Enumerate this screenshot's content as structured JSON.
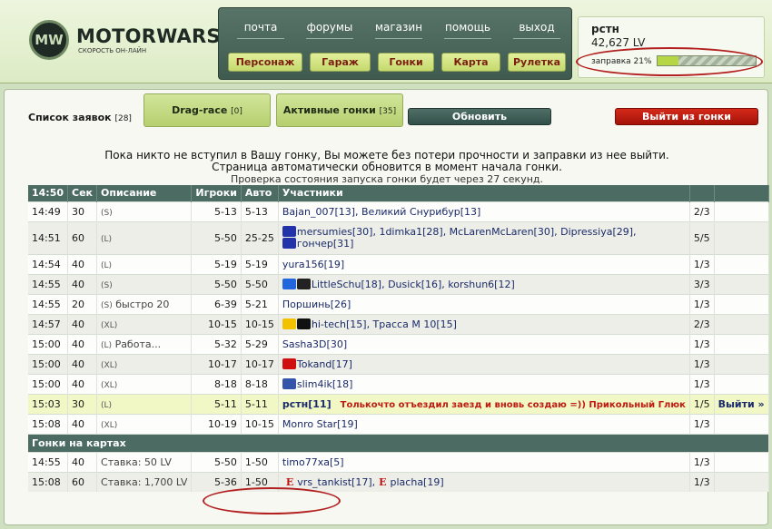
{
  "logo": {
    "mark": "MW",
    "title": "MOTORWARS.RU",
    "subtitle": "скорость он-лайн"
  },
  "nav": {
    "top": [
      "почта",
      "форумы",
      "магазин",
      "помощь",
      "выход"
    ],
    "buttons": [
      "Персонаж",
      "Гараж",
      "Гонки",
      "Карта",
      "Рулетка"
    ]
  },
  "user": {
    "name": "рстн",
    "money": "42,627 LV",
    "fuel_label": "заправка 21%",
    "fuel_percent": 21
  },
  "list_title": "Список заявок",
  "list_count": "[28]",
  "tabs": [
    {
      "label": "Drag-race",
      "count": "[0]"
    },
    {
      "label": "Активные гонки",
      "count": "[35]"
    }
  ],
  "refresh_label": "Обновить",
  "exit_label": "Выйти из гонки",
  "message": {
    "line1": "Пока никто не вступил в Вашу гонку, Вы можете без потери прочности и заправки из нее выйти.",
    "line2": "Страница автоматически обновится в момент начала гонки.",
    "line3": "Проверка состояния запуска гонки будет через 27 секунд."
  },
  "table": {
    "headers": [
      "14:50",
      "Сек",
      "Описание",
      "Игроки",
      "Авто",
      "Участники",
      "",
      ""
    ],
    "rows": [
      {
        "time": "14:49",
        "sec": "30",
        "type": "(S)",
        "desc": "",
        "players": "5-13",
        "auto": "5-13",
        "participants": "Bajan_007[13], Великий Снурибур[13]",
        "count": "2/3"
      },
      {
        "time": "14:51",
        "sec": "60",
        "type": "(L)",
        "desc": "",
        "players": "5-50",
        "auto": "25-25",
        "participants": "mersumies[30], 1dimka1[28], McLarenMcLaren[30], Dipressiya[29],",
        "participants2": "гончер[31]",
        "count": "5/5"
      },
      {
        "time": "14:54",
        "sec": "40",
        "type": "(L)",
        "desc": "",
        "players": "5-19",
        "auto": "5-19",
        "participants": "yura156[19]",
        "count": "1/3"
      },
      {
        "time": "14:55",
        "sec": "40",
        "type": "(S)",
        "desc": "",
        "players": "5-50",
        "auto": "5-50",
        "participants": "LittleSchu[18], Dusick[16], korshun6[12]",
        "count": "3/3"
      },
      {
        "time": "14:55",
        "sec": "20",
        "type": "(S)",
        "desc": "быстро 20",
        "players": "6-39",
        "auto": "5-21",
        "participants": "Поршинь[26]",
        "count": "1/3"
      },
      {
        "time": "14:57",
        "sec": "40",
        "type": "(XL)",
        "desc": "",
        "players": "10-15",
        "auto": "10-15",
        "participants": "hi-tech[15], Трасса М 10[15]",
        "count": "2/3"
      },
      {
        "time": "15:00",
        "sec": "40",
        "type": "(L)",
        "desc": "Работа...",
        "players": "5-32",
        "auto": "5-29",
        "participants": "Sasha3D[30]",
        "count": "1/3"
      },
      {
        "time": "15:00",
        "sec": "40",
        "type": "(XL)",
        "desc": "",
        "players": "10-17",
        "auto": "10-17",
        "participants": "Tokand[17]",
        "count": "1/3"
      },
      {
        "time": "15:00",
        "sec": "40",
        "type": "(XL)",
        "desc": "",
        "players": "8-18",
        "auto": "8-18",
        "participants": "slim4ik[18]",
        "count": "1/3"
      },
      {
        "time": "15:03",
        "sec": "30",
        "type": "(L)",
        "desc": "",
        "players": "5-11",
        "auto": "5-11",
        "participants": "рстн[11]",
        "note": "Толькочто отъездил заезд и вновь создаю =)) Прикольный Глюк",
        "count": "1/5",
        "action": "Выйти »"
      },
      {
        "time": "15:08",
        "sec": "40",
        "type": "(XL)",
        "desc": "",
        "players": "10-19",
        "auto": "10-15",
        "participants": "Monro Star[19]",
        "count": "1/3"
      }
    ],
    "section": "Гонки на картах",
    "map_rows": [
      {
        "time": "14:55",
        "sec": "40",
        "desc": "Ставка: 50 LV",
        "players": "5-50",
        "auto": "1-50",
        "participants": "timo77xa[5]",
        "count": "1/3"
      },
      {
        "time": "15:08",
        "sec": "60",
        "desc": "Ставка: 1,700 LV",
        "players": "5-36",
        "auto": "1-50",
        "participants": "vrs_tankist[17],",
        "participants2": "placha[19]",
        "mark": "E",
        "count": "1/3"
      }
    ]
  }
}
